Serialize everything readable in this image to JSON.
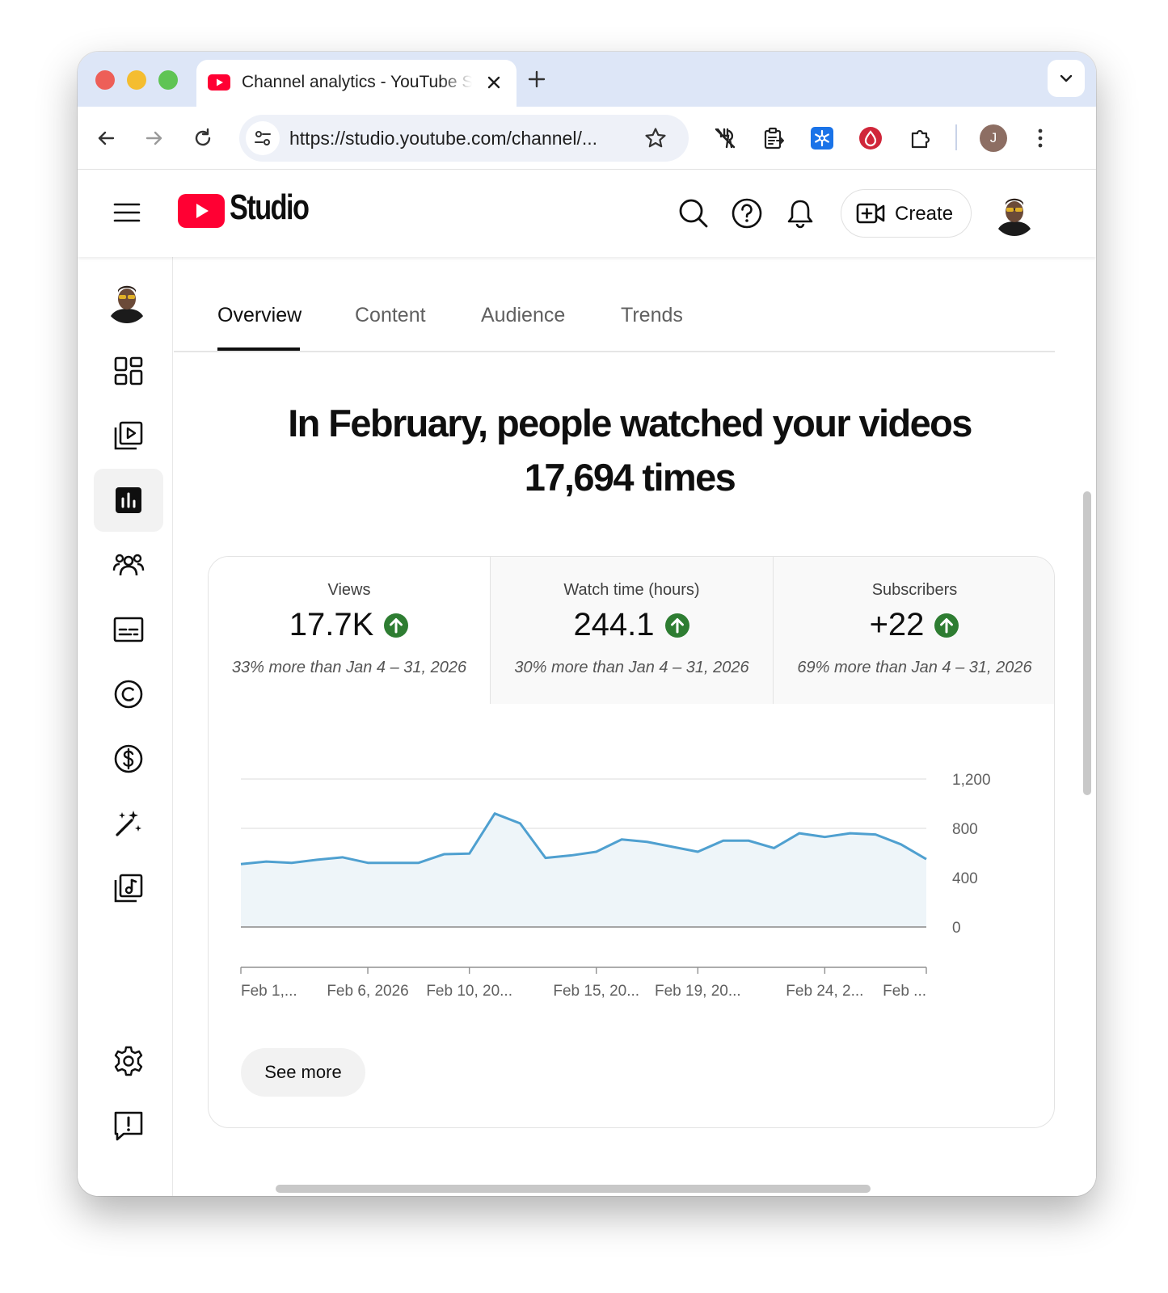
{
  "browser": {
    "tab_title": "Channel analytics - YouTube Studio",
    "url": "https://studio.youtube.com/channel/...",
    "profile_initial": "J"
  },
  "header": {
    "logo_text": "Studio",
    "create_label": "Create"
  },
  "tabs": [
    {
      "label": "Overview",
      "active": true
    },
    {
      "label": "Content",
      "active": false
    },
    {
      "label": "Audience",
      "active": false
    },
    {
      "label": "Trends",
      "active": false
    }
  ],
  "headline": {
    "line1": "In February, people watched your videos",
    "line2": "17,694 times"
  },
  "metrics": [
    {
      "label": "Views",
      "value": "17.7K",
      "trend": "up",
      "compare": "33% more than Jan 4 – 31, 2026"
    },
    {
      "label": "Watch time (hours)",
      "value": "244.1",
      "trend": "up",
      "compare": "30% more than Jan 4 – 31, 2026"
    },
    {
      "label": "Subscribers",
      "value": "+22",
      "trend": "up",
      "compare": "69% more than Jan 4 – 31, 2026"
    }
  ],
  "chart_data": {
    "type": "area",
    "x": [
      1,
      2,
      3,
      4,
      5,
      6,
      7,
      8,
      9,
      10,
      11,
      12,
      13,
      14,
      15,
      16,
      17,
      18,
      19,
      20,
      21,
      22,
      23,
      24,
      25,
      26,
      27,
      28
    ],
    "values": [
      510,
      530,
      520,
      545,
      565,
      520,
      520,
      520,
      590,
      595,
      920,
      840,
      560,
      580,
      610,
      710,
      690,
      650,
      610,
      700,
      700,
      640,
      760,
      730,
      760,
      750,
      670,
      550
    ],
    "yticks": [
      0,
      400,
      800,
      "1,200"
    ],
    "ylim": [
      0,
      1200
    ],
    "xtick_labels": [
      {
        "day": 1,
        "label": "Feb 1,..."
      },
      {
        "day": 6,
        "label": "Feb 6, 2026"
      },
      {
        "day": 10,
        "label": "Feb 10, 20..."
      },
      {
        "day": 15,
        "label": "Feb 15, 20..."
      },
      {
        "day": 19,
        "label": "Feb 19, 20..."
      },
      {
        "day": 24,
        "label": "Feb 24, 2..."
      },
      {
        "day": 28,
        "label": "Feb ..."
      }
    ],
    "grid": true,
    "line_color": "#4fa0d0",
    "fill_color": "#eef5f9"
  },
  "see_more_label": "See more",
  "colors": {
    "youtube_red": "#ff0033",
    "trend_up": "#2e7d32"
  }
}
